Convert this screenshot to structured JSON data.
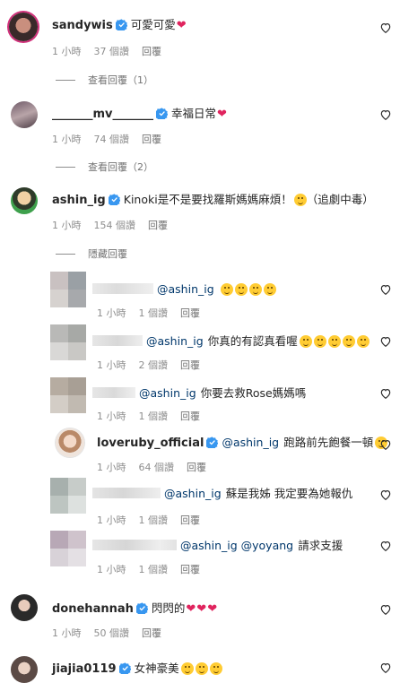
{
  "comments": [
    {
      "user": "sandywis",
      "text": "可愛可愛",
      "time": "1 小時",
      "likes": "37 個讚",
      "reply": "回覆",
      "view": "查看回覆（1）"
    },
    {
      "user": "_______mv_______",
      "text": "幸福日常",
      "time": "1 小時",
      "likes": "74 個讚",
      "reply": "回覆",
      "view": "查看回覆（2）"
    },
    {
      "user": "ashin_ig",
      "text": "Kinoki是不是要找羅斯媽媽麻煩！",
      "text2": "（追劇中毒）",
      "time": "1 小時",
      "likes": "154 個讚",
      "reply": "回覆",
      "view": "隱藏回覆"
    },
    {
      "user": "donehannah",
      "text": "閃閃的",
      "time": "1 小時",
      "likes": "50 個讚",
      "reply": "回覆"
    },
    {
      "user": "jiajia0119",
      "text": "女神豪美"
    }
  ],
  "replies": [
    {
      "user": "",
      "mention": "@ashin_ig",
      "text": "",
      "time": "1 小時",
      "likes": "1 個讚",
      "reply": "回覆"
    },
    {
      "user": "",
      "mention": "@ashin_ig",
      "text": "你真的有認真看喔",
      "time": "1 小時",
      "likes": "2 個讚",
      "reply": "回覆"
    },
    {
      "user": "",
      "mention": "@ashin_ig",
      "text": "你要去救Rose媽媽嗎",
      "time": "1 小時",
      "likes": "1 個讚",
      "reply": "回覆"
    },
    {
      "user": "loveruby_official",
      "mention": "@ashin_ig",
      "text": "跑路前先飽餐一頓",
      "time": "1 小時",
      "likes": "64 個讚",
      "reply": "回覆"
    },
    {
      "user": "",
      "mention": "@ashin_ig",
      "text": "蘇是我姊 我定要為她報仇",
      "time": "1 小時",
      "likes": "1 個讚",
      "reply": "回覆"
    },
    {
      "user": "",
      "mention": "@ashin_ig @yoyang",
      "text": "請求支援",
      "time": "1 小時",
      "likes": "1 個讚",
      "reply": "回覆"
    }
  ],
  "colors": {
    "verified": "#3897f0",
    "heart": "#e0245e",
    "meta": "#8e8e8e",
    "mention": "#00376b"
  }
}
